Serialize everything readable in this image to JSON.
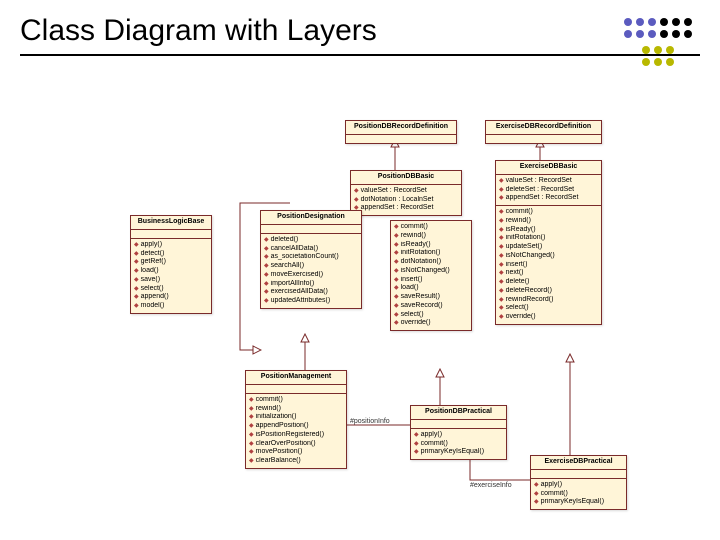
{
  "title": "Class Diagram with Layers",
  "classes": {
    "positionDbRecordDef": {
      "name": "PositionDBRecordDefinition",
      "attrs": [],
      "ops": []
    },
    "exerciseDbRecordDef": {
      "name": "ExerciseDBRecordDefinition",
      "attrs": [],
      "ops": []
    },
    "positionDbBasic": {
      "name": "PositionDBBasic",
      "attrs": [
        "valueSet : RecordSet",
        "dotNotation : LocalnSet",
        "appendSet : RecordSet"
      ],
      "ops": []
    },
    "exerciseDbBasic": {
      "name": "ExerciseDBBasic",
      "attrs": [
        "valueSet : RecordSet",
        "deleteSet : RecordSet",
        "appendSet : RecordSet"
      ],
      "ops": [
        "commit()",
        "rewind()",
        "isReady()",
        "initRotation()",
        "updateSet()",
        "isNotChanged()",
        "insert()",
        "next()",
        "delete()",
        "deleteRecord()",
        "rewindRecord()",
        "select()",
        "override()"
      ]
    },
    "businessLogicBase": {
      "name": "BusinessLogicBase",
      "attrs": [],
      "ops": [
        "apply()",
        "detect()",
        "getRef()",
        "load()",
        "save()",
        "select()",
        "append()",
        "model()"
      ]
    },
    "positionDesignation": {
      "name": "PositionDesignation",
      "attrs": [],
      "ops": [
        "deleted()",
        "cancelAllData()",
        "as_societationCount()",
        "searchAll()",
        "moveExercised()",
        "importAllInfo()",
        "exercisedAllData()",
        "updatedAttributes()"
      ]
    },
    "positionDbOps": {
      "ops": [
        "commit()",
        "rewind()",
        "isReady()",
        "initRotation()",
        "dotNotation()",
        "isNotChanged()",
        "insert()",
        "load()",
        "saveResult()",
        "saveRecord()",
        "select()",
        "override()"
      ]
    },
    "positionManagement": {
      "name": "PositionManagement",
      "attrs": [],
      "ops": [
        "commit()",
        "rewind()",
        "initialization()",
        "appendPosition()",
        "isPositionRegistered()",
        "clearOverPosition()",
        "movePosition()",
        "clearBalance()"
      ]
    },
    "positionDbPractical": {
      "name": "PositionDBPractical",
      "attrs": [],
      "ops": [
        "apply()",
        "commit()",
        "primaryKeyIsEqual()"
      ]
    },
    "exerciseDbPractical": {
      "name": "ExerciseDBPractical",
      "attrs": [],
      "ops": [
        "apply()",
        "commit()",
        "primaryKeyIsEqual()"
      ]
    }
  },
  "assocLabels": {
    "positionInfo": "#positionInfo",
    "exerciseInfo": "#exerciseInfo"
  }
}
